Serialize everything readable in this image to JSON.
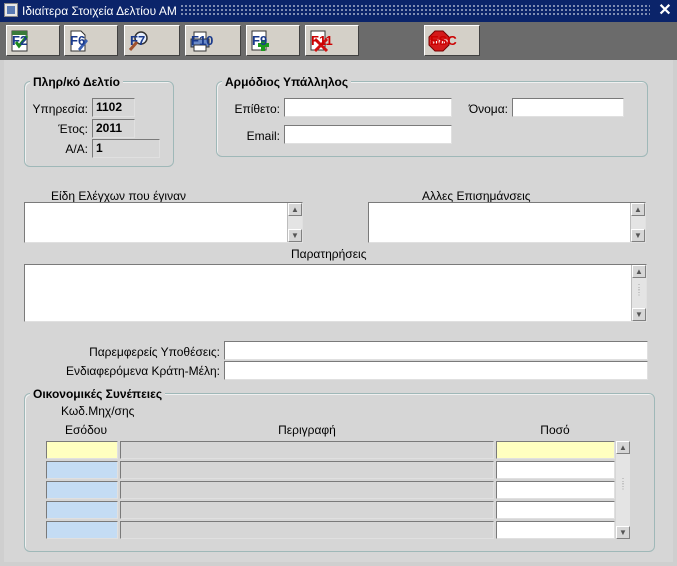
{
  "window": {
    "title": "Ιδιαίτερα Στοιχεία Δελτίου ΑΜ",
    "close_glyph": "✕"
  },
  "toolbar": {
    "buttons": [
      {
        "label": "F2",
        "icon": "checklist-icon"
      },
      {
        "label": "F6",
        "icon": "edit-document-icon"
      },
      {
        "label": "F7",
        "icon": "search-magnifier-icon"
      },
      {
        "label": "F10",
        "icon": "printer-icon"
      },
      {
        "label": "F9",
        "icon": "add-record-icon"
      },
      {
        "label": "F11",
        "icon": "delete-record-icon"
      },
      {
        "label": "ESC",
        "icon": "stop-sign-icon",
        "stop_text": "STOP"
      }
    ]
  },
  "info_group": {
    "title": "Πληρ/κό Δελτίο",
    "service_label": "Υπηρεσία:",
    "service_value": "1102",
    "year_label": "Έτος:",
    "year_value": "2011",
    "aa_label": "Α/Α:",
    "aa_value": "1"
  },
  "officer_group": {
    "title": "Αρμόδιος Υπάλληλος",
    "surname_label": "Επίθετο:",
    "surname_value": "",
    "name_label": "Όνομα:",
    "name_value": "",
    "email_label": "Email:",
    "email_value": ""
  },
  "notes": {
    "types_label": "Είδη Ελέγχων που έγιναν",
    "other_label": "Αλλες Επισημάνσεις",
    "remarks_label": "Παρατηρήσεις"
  },
  "related": {
    "cases_label": "Παρεμφερείς Υποθέσεις:",
    "cases_value": "",
    "states_label": "Ενδιαφερόμενα Κράτη-Μέλη:",
    "states_value": ""
  },
  "financial": {
    "title": "Οικονομικές Συνέπειες",
    "code_header_line1": "Κωδ.Μηχ/σης",
    "code_header_line2": "Εσόδου",
    "desc_header": "Περιγραφή",
    "amount_header": "Ποσό",
    "rows": [
      {
        "code": "",
        "description": "",
        "amount": ""
      },
      {
        "code": "",
        "description": "",
        "amount": ""
      },
      {
        "code": "",
        "description": "",
        "amount": ""
      },
      {
        "code": "",
        "description": "",
        "amount": ""
      },
      {
        "code": "",
        "description": "",
        "amount": ""
      }
    ]
  },
  "colors": {
    "titlebar": "#0b246a",
    "toolbar": "#6b6b6b",
    "panel": "#d6d6d6",
    "current_row": "#ffffc0",
    "code_cell": "#c4dcf4",
    "toolbar_label": "#1a3a8c",
    "delete_label": "#cc0000"
  }
}
